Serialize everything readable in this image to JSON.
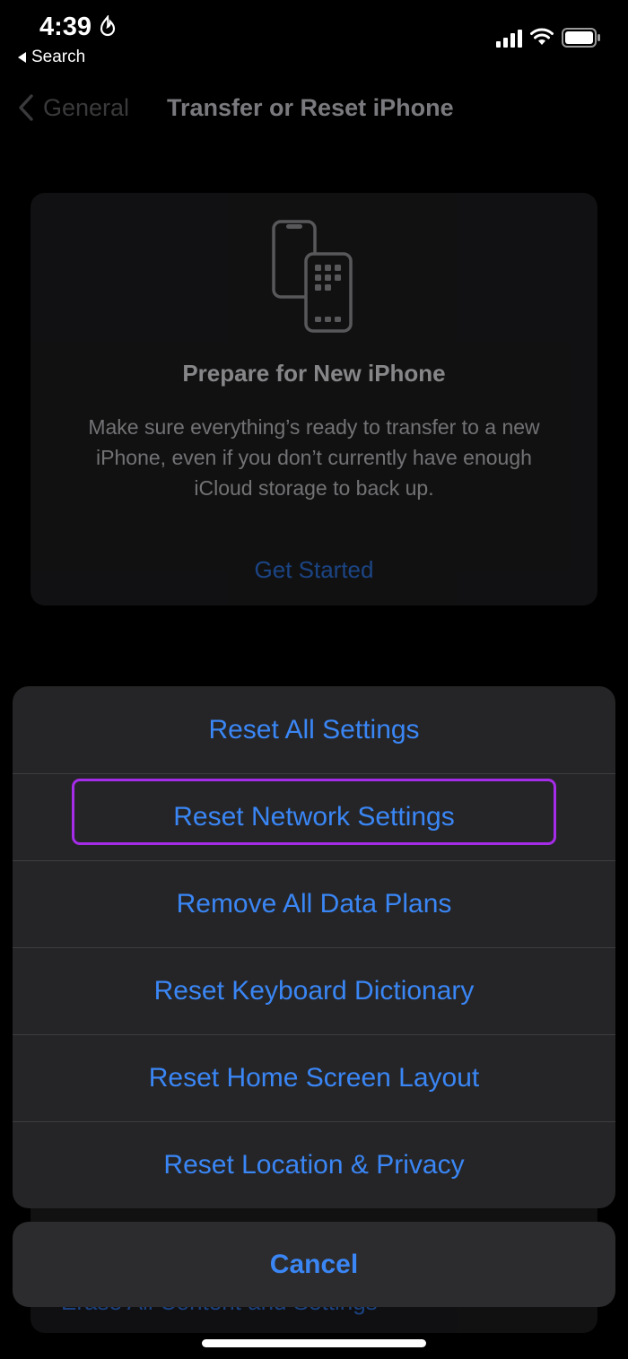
{
  "status_bar": {
    "time": "4:39",
    "back_app_label": "Search",
    "icons": [
      "focus-icon",
      "signal-icon",
      "wifi-icon",
      "battery-icon"
    ]
  },
  "nav": {
    "back_label": "General",
    "title": "Transfer or Reset iPhone"
  },
  "prepare_card": {
    "icon": "phones-icon",
    "title": "Prepare for New iPhone",
    "description": "Make sure everything’s ready to transfer to a new iPhone, even if you don’t currently have enough iCloud storage to back up.",
    "link": "Get Started"
  },
  "hidden_card": {
    "text": "Erase All Content and Settings"
  },
  "action_sheet": {
    "items": [
      {
        "label": "Reset All Settings"
      },
      {
        "label": "Reset Network Settings",
        "highlighted": true
      },
      {
        "label": "Remove All Data Plans"
      },
      {
        "label": "Reset Keyboard Dictionary"
      },
      {
        "label": "Reset Home Screen Layout"
      },
      {
        "label": "Reset Location & Privacy"
      }
    ],
    "cancel_label": "Cancel"
  },
  "colors": {
    "accent": "#3a86f5",
    "highlight": "#a52ce8",
    "sheet_bg": "#252527",
    "background": "#000000"
  }
}
